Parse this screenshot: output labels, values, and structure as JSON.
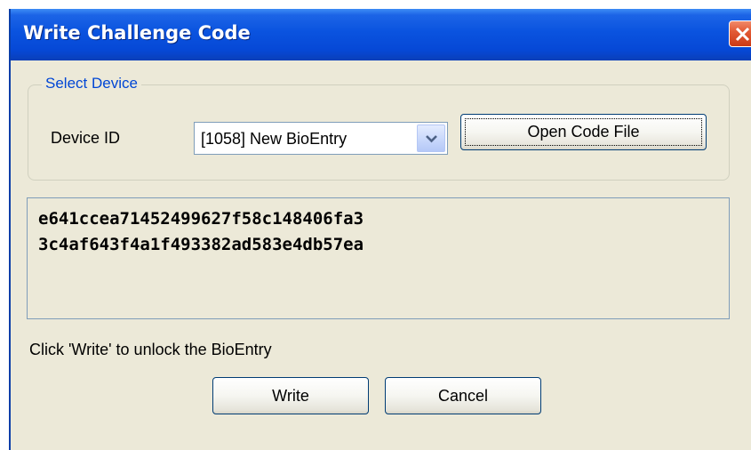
{
  "window": {
    "title": "Write Challenge Code"
  },
  "select_device": {
    "legend": "Select Device",
    "device_id_label": "Device ID",
    "device_id_value": "[1058] New BioEntry",
    "open_code_file_label": "Open Code File"
  },
  "challenge_code": {
    "line1": "e641ccea71452499627f58c148406fa3",
    "line2": "3c4af643f4a1f493382ad583e4db57ea"
  },
  "instruction": "Click 'Write' to unlock the BioEntry",
  "buttons": {
    "write_label": "Write",
    "cancel_label": "Cancel"
  },
  "colors": {
    "titlebar": "#0a53df",
    "window_bg": "#ece9d8",
    "legend_text": "#0046d5",
    "close_button": "#e35b35"
  },
  "icons": {
    "close": "close-icon",
    "dropdown": "chevron-down-icon"
  }
}
